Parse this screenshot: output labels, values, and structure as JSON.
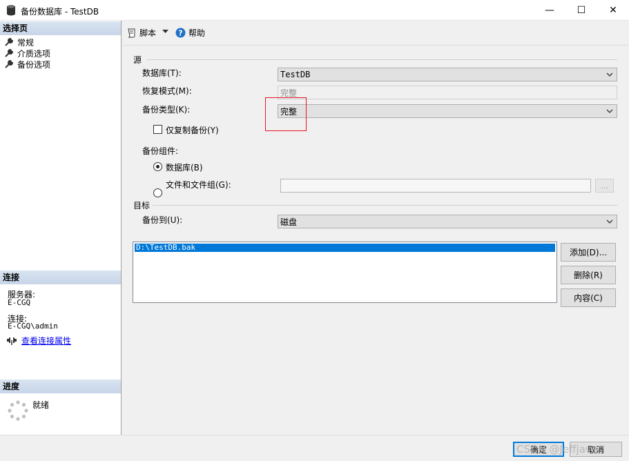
{
  "window": {
    "title": "备份数据库 - TestDB",
    "minimize": "—",
    "maximize": "☐",
    "close": "✕"
  },
  "sidebar": {
    "select_page": "选择页",
    "pages": [
      {
        "label": "常规"
      },
      {
        "label": "介质选项"
      },
      {
        "label": "备份选项"
      }
    ],
    "connection": {
      "header": "连接",
      "server_label": "服务器:",
      "server_value": "E-CGQ",
      "conn_label": "连接:",
      "conn_value": "E-CGQ\\admin",
      "view_props": "查看连接属性"
    },
    "progress": {
      "header": "进度",
      "status": "就绪"
    }
  },
  "toolbar": {
    "script": "脚本",
    "help": "帮助"
  },
  "source": {
    "group": "源",
    "database_label": "数据库(T):",
    "database_value": "TestDB",
    "recovery_label": "恢复模式(M):",
    "recovery_value": "完整",
    "backup_type_label": "备份类型(K):",
    "backup_type_value": "完整",
    "copy_only_label": "仅复制备份(Y)",
    "copy_only_checked": false,
    "component_label": "备份组件:",
    "component_db": "数据库(B)",
    "component_files": "文件和文件组(G):",
    "browse": "..."
  },
  "destination": {
    "group": "目标",
    "backup_to_label": "备份到(U):",
    "backup_to_value": "磁盘",
    "paths": [
      "D:\\TestDB.bak"
    ],
    "add": "添加(D)...",
    "remove": "删除(R)",
    "contents": "内容(C)"
  },
  "footer": {
    "ok": "确定",
    "cancel": "取消",
    "watermark": "CSDN @Jeffjava"
  },
  "colors": {
    "accent": "#0078d7",
    "highlight_box": "#e81123"
  }
}
